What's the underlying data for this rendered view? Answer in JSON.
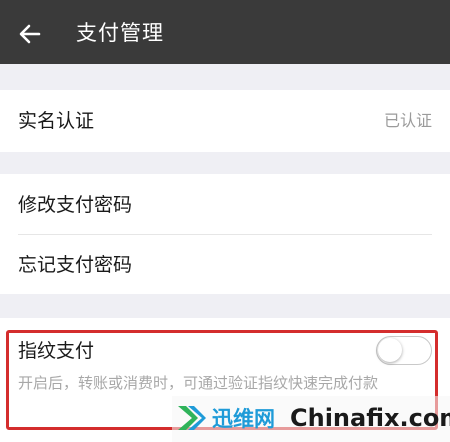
{
  "header": {
    "title": "支付管理",
    "back_icon": "back-arrow-icon"
  },
  "identity": {
    "label": "实名认证",
    "status": "已认证"
  },
  "password": {
    "change_label": "修改支付密码",
    "forgot_label": "忘记支付密码"
  },
  "fingerprint": {
    "label": "指纹支付",
    "enabled": false,
    "description": "开启后，转账或消费时，可通过验证指纹快速完成付款"
  },
  "watermark": {
    "brand_cn": "迅维网",
    "brand_en": "Chinafix.com"
  },
  "colors": {
    "header_bg": "#3a3a3a",
    "highlight": "#d42d2d",
    "brand_blue": "#1f9bd8"
  }
}
